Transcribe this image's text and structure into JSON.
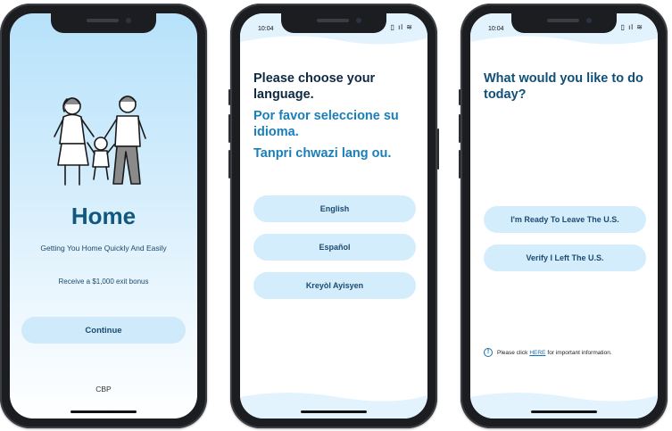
{
  "screens": {
    "welcome": {
      "title": "Home",
      "subtitle": "Getting You Home Quickly And Easily",
      "bonus": "Receive a $1,000 exit bonus",
      "continue_label": "Continue",
      "footer": "CBP"
    },
    "language": {
      "status_time": "10:04",
      "heading_en": "Please choose your language.",
      "heading_es": "Por favor seleccione su idioma.",
      "heading_ht": "Tanpri chwazi lang ou.",
      "options": [
        "English",
        "Español",
        "Kreyòl Ayisyen"
      ]
    },
    "action": {
      "status_time": "10:04",
      "heading": "What would you like to do today?",
      "options": [
        "I'm Ready To Leave The U.S.",
        "Verify I Left The U.S."
      ],
      "info_prefix": "Please click",
      "info_link": "HERE",
      "info_suffix": "for important information."
    }
  },
  "colors": {
    "accent_dark": "#11577f",
    "accent": "#1a7fb9",
    "pill": "#d4edfc",
    "frame": "#1b1d20"
  },
  "icons": {
    "status": "signal-wifi-battery",
    "info": "info-circle-icon"
  }
}
